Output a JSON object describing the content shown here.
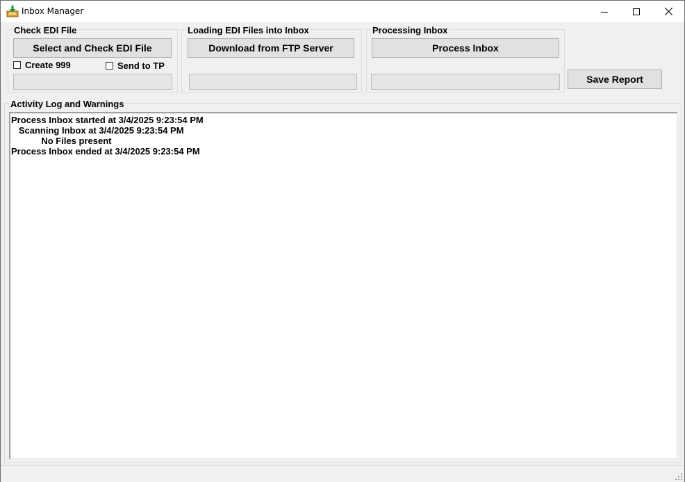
{
  "window": {
    "title": "Inbox Manager",
    "icon": "inbox-download-icon"
  },
  "controls": {
    "minimize": "minimize-icon",
    "maximize": "maximize-icon",
    "close": "close-icon"
  },
  "check_group": {
    "title": "Check EDI File",
    "button_label": "Select and Check EDI File",
    "create999_label": "Create 999",
    "create999_checked": false,
    "send_to_tp_label": "Send to TP",
    "send_to_tp_checked": false,
    "progress": 0
  },
  "loading_group": {
    "title": "Loading EDI Files into Inbox",
    "button_label": "Download from FTP Server",
    "progress": 0
  },
  "processing_group": {
    "title": "Processing Inbox",
    "button_label": "Process Inbox",
    "progress": 0
  },
  "save_report_label": "Save Report",
  "activity_log": {
    "title": "Activity Log and Warnings",
    "lines": [
      "Process Inbox started at 3/4/2025 9:23:54 PM",
      "   Scanning Inbox at 3/4/2025 9:23:54 PM",
      "            No Files present",
      "Process Inbox ended at 3/4/2025 9:23:54 PM"
    ]
  },
  "colors": {
    "window_bg": "#f0f0f0",
    "button_bg": "#e1e1e1",
    "button_border": "#adadad",
    "log_bg": "#ffffff"
  }
}
